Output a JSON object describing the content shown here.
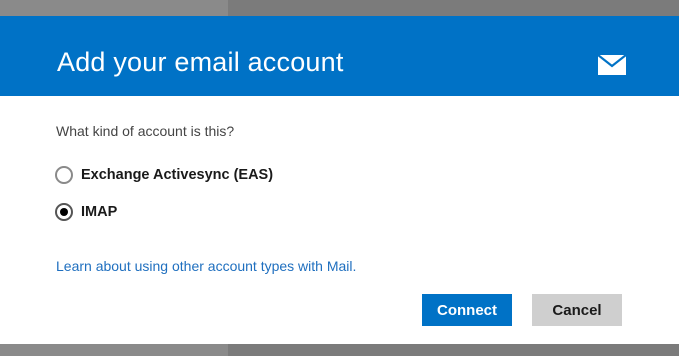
{
  "dialog": {
    "title": "Add your email account",
    "header_icon": "mail-envelope-icon",
    "question": "What kind of account is this?",
    "options": [
      {
        "label": "Exchange Activesync (EAS)",
        "selected": false
      },
      {
        "label": "IMAP",
        "selected": true
      }
    ],
    "link_text": "Learn about using other account types with Mail.",
    "buttons": {
      "connect_label": "Connect",
      "cancel_label": "Cancel"
    }
  },
  "colors": {
    "header_bg": "#0072c6",
    "primary_button": "#0072c6",
    "secondary_button": "#cfcfcf",
    "link": "#1f6fbf"
  }
}
